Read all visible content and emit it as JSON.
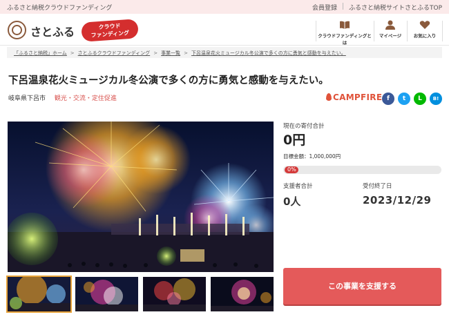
{
  "topbar": {
    "tagline": "ふるさと納税クラウドファンディング",
    "links": [
      "会員登録",
      "ふるさと納税サイトさとふるTOP"
    ]
  },
  "header": {
    "logo_text": "さとふる",
    "badge_line1": "クラウド",
    "badge_line2": "ファンディング",
    "nav": [
      {
        "label": "クラウドファンディングとは",
        "icon": "open-book-icon"
      },
      {
        "label": "マイページ",
        "icon": "person-icon"
      },
      {
        "label": "お気に入り",
        "icon": "heart-icon"
      }
    ]
  },
  "breadcrumb": {
    "items": [
      "「ふるさと納税」ホーム",
      "さとふるクラウドファンディング",
      "事業一覧",
      "下呂温泉花火ミュージカル冬公演で多くの方に勇気と感動を与えたい。"
    ],
    "separator": ">"
  },
  "project": {
    "title": "下呂温泉花火ミュージカル冬公演で多くの方に勇気と感動を与えたい。",
    "location": "岐阜県下呂市",
    "category": "観光・交流・定住促進",
    "platform": "CAMPFIRE"
  },
  "share": [
    {
      "name": "facebook",
      "glyph": "f",
      "color": "#3b5998"
    },
    {
      "name": "twitter",
      "glyph": "t",
      "color": "#1da1f2"
    },
    {
      "name": "line",
      "glyph": "L",
      "color": "#00b900"
    },
    {
      "name": "hatena",
      "glyph": "B!",
      "color": "#008fde"
    }
  ],
  "stats": {
    "raised_label": "現在の寄付合計",
    "raised_value": "0円",
    "target_text": "目標金額：1,000,000円",
    "progress_label": "0%",
    "progress_fraction": 0.0,
    "supporters_label": "支援者合計",
    "supporters_value": "0人",
    "deadline_label": "受付終了日",
    "deadline_value": "2023/12/29"
  },
  "cta": {
    "label": "この事業を支援する"
  },
  "colors": {
    "accent": "#e45a5a",
    "topbar_bg": "#fbeaea",
    "campfire": "#e0533a"
  }
}
